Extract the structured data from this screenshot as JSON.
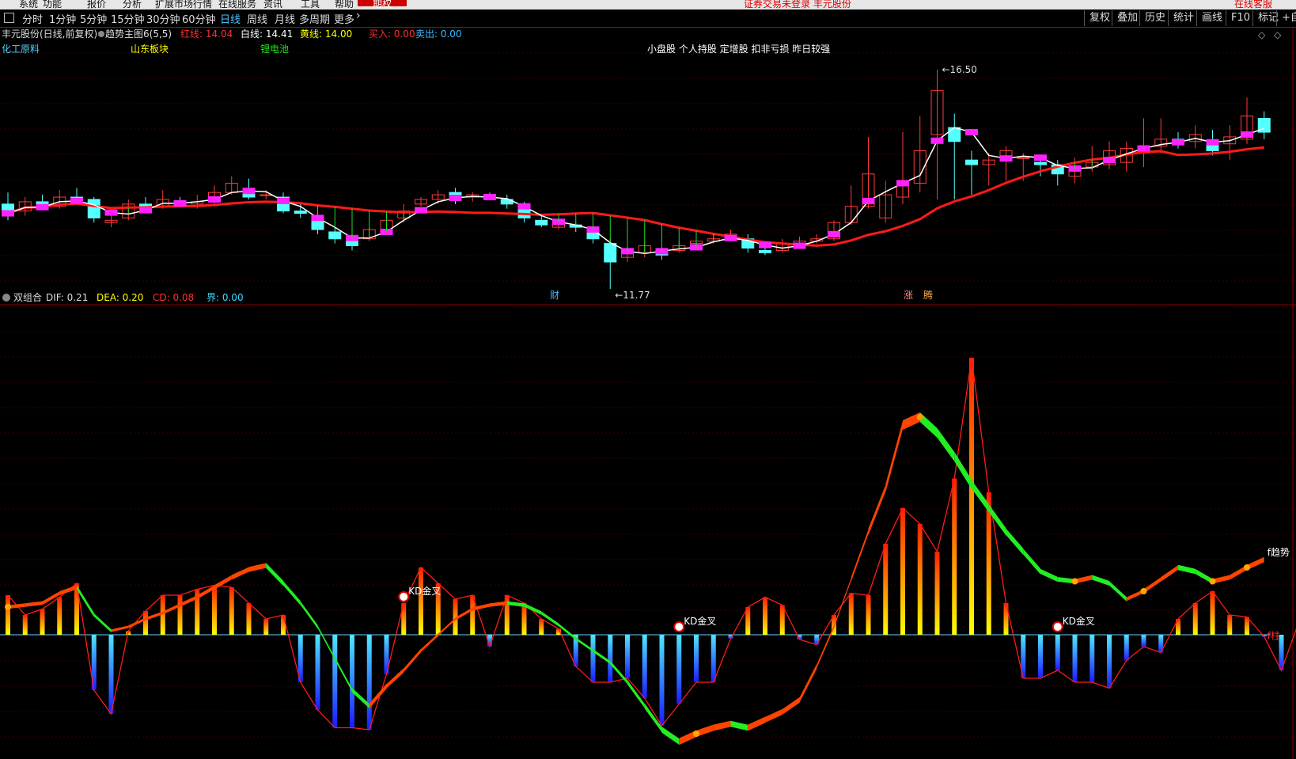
{
  "menu": {
    "items": [
      "系统",
      "功能",
      "报价",
      "分析",
      "扩展市场行情",
      "在线服务",
      "资讯",
      "工具",
      "帮助"
    ],
    "hot": "期权",
    "status": "证券交易未登录  丰元股份",
    "right": "在线客服"
  },
  "periods": {
    "items": [
      "分时",
      "1分钟",
      "5分钟",
      "15分钟",
      "30分钟",
      "60分钟",
      "日线",
      "周线",
      "月线",
      "多周期",
      "更多"
    ],
    "active": "日线"
  },
  "tools": {
    "items": [
      "复权",
      "叠加",
      "历史",
      "统计",
      "画线",
      "F10",
      "标记",
      "+自"
    ]
  },
  "main": {
    "stock": "丰元股份(日线,前复权)",
    "indicator": "趋势主图6(5,5)",
    "red_line": "红线: 14.04",
    "white_line": "白线: 14.41",
    "yellow_line": "黄线: 14.00",
    "buy": "买入: 0.00",
    "sell": "卖出: 0.00",
    "tags": [
      "化工原料",
      "山东板块",
      "锂电池"
    ],
    "notice": "小盘股 个人持股 定增股 扣非亏损 昨日较强",
    "high_label": "16.50",
    "low_label": "11.77",
    "marker_cai": "财",
    "marker_zhang": "涨",
    "marker_teng": "腾"
  },
  "sub": {
    "name": "双组合",
    "dif": "DIF: 0.21",
    "dea": "DEA: 0.20",
    "cd": "CD: 0.08",
    "jie": "界: 0.00",
    "kd1": "KD金叉",
    "kd2": "KD金叉",
    "kd3": "KD金叉",
    "trend": "f趋势",
    "zhu": "f柱"
  },
  "colors": {
    "up": "#ff3b3b",
    "down": "#54ffff",
    "ma_red": "#ff1a1a",
    "ma_white": "#ffffff",
    "magenta": "#ff22ff",
    "bull": "#ff4400",
    "bear": "#22ee22"
  },
  "chart_data": {
    "type": "candlestick",
    "candles": [
      [
        13.6,
        13.4,
        13.85,
        13.25
      ],
      [
        13.45,
        13.65,
        13.75,
        13.35
      ],
      [
        13.65,
        13.55,
        13.8,
        13.5
      ],
      [
        13.55,
        13.75,
        13.9,
        13.5
      ],
      [
        13.75,
        13.7,
        13.95,
        13.6
      ],
      [
        13.7,
        13.3,
        13.75,
        13.2
      ],
      [
        13.2,
        13.25,
        13.4,
        13.1
      ],
      [
        13.3,
        13.6,
        13.7,
        13.25
      ],
      [
        13.6,
        13.55,
        13.75,
        13.45
      ],
      [
        13.55,
        13.7,
        13.9,
        13.5
      ],
      [
        13.65,
        13.6,
        13.75,
        13.55
      ],
      [
        13.6,
        13.65,
        13.8,
        13.5
      ],
      [
        13.65,
        13.85,
        14.0,
        13.55
      ],
      [
        13.85,
        14.05,
        14.2,
        13.8
      ],
      [
        13.85,
        13.75,
        14.15,
        13.7
      ],
      [
        13.8,
        13.8,
        13.9,
        13.7
      ],
      [
        13.75,
        13.45,
        13.85,
        13.4
      ],
      [
        13.45,
        13.4,
        13.6,
        13.3
      ],
      [
        13.35,
        13.05,
        13.45,
        12.95
      ],
      [
        13.0,
        12.85,
        13.1,
        12.75
      ],
      [
        12.85,
        12.7,
        12.95,
        12.6
      ],
      [
        12.85,
        13.05,
        13.1,
        12.8
      ],
      [
        13.05,
        13.25,
        13.45,
        13.0
      ],
      [
        13.3,
        13.45,
        13.6,
        13.2
      ],
      [
        13.6,
        13.7,
        13.75,
        13.55
      ],
      [
        13.7,
        13.8,
        13.9,
        13.6
      ],
      [
        13.85,
        13.7,
        13.95,
        13.6
      ],
      [
        13.75,
        13.8,
        13.85,
        13.65
      ],
      [
        13.8,
        13.75,
        13.85,
        13.7
      ],
      [
        13.7,
        13.6,
        13.8,
        13.5
      ],
      [
        13.55,
        13.3,
        13.65,
        13.2
      ],
      [
        13.25,
        13.15,
        13.35,
        13.1
      ],
      [
        13.1,
        13.2,
        13.3,
        13.05
      ],
      [
        13.15,
        13.1,
        13.2,
        13.0
      ],
      [
        13.05,
        12.85,
        13.15,
        12.75
      ],
      [
        12.75,
        12.35,
        12.85,
        11.77
      ],
      [
        12.45,
        12.55,
        12.6,
        12.35
      ],
      [
        12.55,
        12.7,
        12.8,
        12.45
      ],
      [
        12.6,
        12.5,
        12.7,
        12.4
      ],
      [
        12.6,
        12.7,
        12.8,
        12.55
      ],
      [
        12.75,
        12.8,
        12.9,
        12.65
      ],
      [
        12.8,
        12.85,
        12.95,
        12.75
      ],
      [
        12.9,
        12.95,
        13.05,
        12.85
      ],
      [
        12.85,
        12.65,
        12.95,
        12.55
      ],
      [
        12.6,
        12.55,
        12.7,
        12.5
      ],
      [
        12.6,
        12.75,
        12.85,
        12.55
      ],
      [
        12.75,
        12.8,
        12.9,
        12.7
      ],
      [
        12.8,
        12.85,
        12.95,
        12.75
      ],
      [
        12.85,
        13.2,
        13.25,
        12.8
      ],
      [
        13.2,
        13.55,
        14.0,
        13.15
      ],
      [
        13.55,
        14.25,
        15.05,
        13.5
      ],
      [
        13.3,
        13.8,
        14.1,
        13.2
      ],
      [
        13.75,
        14.1,
        15.15,
        13.6
      ],
      [
        14.05,
        14.75,
        15.5,
        13.85
      ],
      [
        15.1,
        16.05,
        16.5,
        13.7
      ],
      [
        15.25,
        14.95,
        15.55,
        13.7
      ],
      [
        14.55,
        14.45,
        14.75,
        13.8
      ],
      [
        14.45,
        14.55,
        14.7,
        14.0
      ],
      [
        14.55,
        14.75,
        14.85,
        14.1
      ],
      [
        14.6,
        14.6,
        14.7,
        14.1
      ],
      [
        14.5,
        14.45,
        14.6,
        14.2
      ],
      [
        14.45,
        14.25,
        14.55,
        14.0
      ],
      [
        14.2,
        14.4,
        14.6,
        14.05
      ],
      [
        14.4,
        14.5,
        14.85,
        14.3
      ],
      [
        14.45,
        14.75,
        14.95,
        14.35
      ],
      [
        14.5,
        14.8,
        14.95,
        14.3
      ],
      [
        14.7,
        14.85,
        15.45,
        14.4
      ],
      [
        14.85,
        15.0,
        15.45,
        14.7
      ],
      [
        15.0,
        14.95,
        15.15,
        14.8
      ],
      [
        14.95,
        15.1,
        15.3,
        14.8
      ],
      [
        14.95,
        14.75,
        15.2,
        14.65
      ],
      [
        14.9,
        15.05,
        15.3,
        14.55
      ],
      [
        15.0,
        15.5,
        15.9,
        14.9
      ],
      [
        15.45,
        15.15,
        15.6,
        15.0
      ]
    ],
    "high": 16.5,
    "low": 11.77,
    "sub_hist": [
      1.0,
      0.5,
      0.65,
      0.95,
      1.3,
      -1.4,
      -2.0,
      0.1,
      0.6,
      1.0,
      1.0,
      1.15,
      1.25,
      1.2,
      0.8,
      0.4,
      0.5,
      -1.2,
      -1.9,
      -2.35,
      -2.35,
      -2.4,
      -1.0,
      0.8,
      1.7,
      1.3,
      0.9,
      1.0,
      -0.3,
      1.0,
      0.8,
      0.4,
      0.15,
      -0.8,
      -1.2,
      -1.2,
      -1.1,
      -1.6,
      -2.3,
      -1.75,
      -1.2,
      -1.2,
      -0.1,
      0.7,
      0.95,
      0.75,
      -0.12,
      -0.25,
      0.5,
      1.05,
      1.0,
      2.3,
      3.2,
      2.8,
      2.1,
      3.95,
      7.0,
      3.6,
      0.8,
      -1.1,
      -1.1,
      -0.9,
      -1.2,
      -1.2,
      -1.35,
      -0.65,
      -0.3,
      -0.45,
      0.4,
      0.8,
      1.1,
      0.5,
      0.45,
      -0.05,
      -0.9,
      0.3,
      1.3
    ],
    "trend_line": [
      0.7,
      0.75,
      0.8,
      1.05,
      1.2,
      0.5,
      0.1,
      0.2,
      0.4,
      0.55,
      0.75,
      0.95,
      1.2,
      1.45,
      1.65,
      1.75,
      1.3,
      0.8,
      0.2,
      -0.6,
      -1.4,
      -1.8,
      -1.3,
      -0.9,
      -0.4,
      0.0,
      0.4,
      0.65,
      0.75,
      0.8,
      0.75,
      0.55,
      0.25,
      -0.1,
      -0.4,
      -0.7,
      -1.2,
      -1.8,
      -2.4,
      -2.7,
      -2.5,
      -2.35,
      -2.25,
      -2.35,
      -2.15,
      -1.95,
      -1.65,
      -0.8,
      0.2,
      1.4,
      2.6,
      3.7,
      5.3,
      5.5,
      5.1,
      4.5,
      3.8,
      3.2,
      2.6,
      2.1,
      1.6,
      1.4,
      1.35,
      1.45,
      1.3,
      0.9,
      1.1,
      1.4,
      1.7,
      1.6,
      1.35,
      1.45,
      1.7,
      1.9
    ]
  }
}
